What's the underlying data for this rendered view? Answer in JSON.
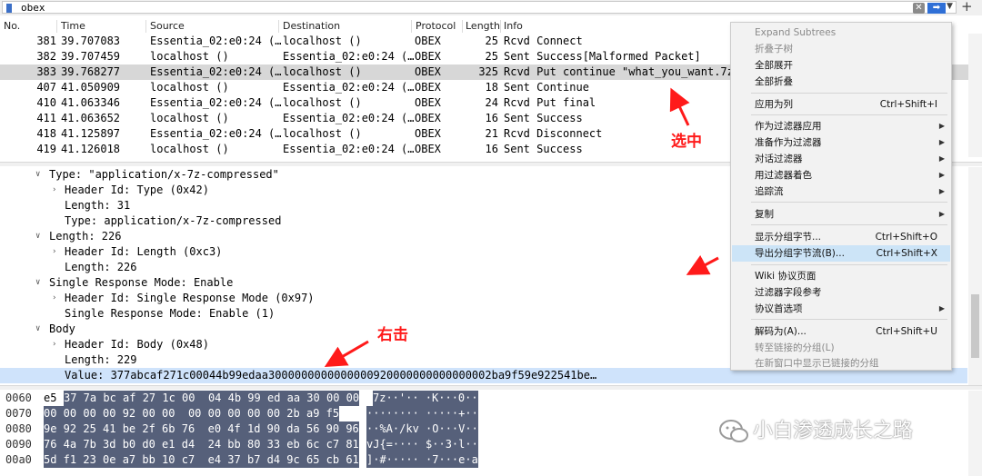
{
  "filter": {
    "value": "obex",
    "clear_glyph": "✕",
    "apply_glyph": "➡",
    "dropdown_glyph": "▼",
    "add_glyph": "+"
  },
  "packet_list": {
    "columns": [
      "No.",
      "Time",
      "Source",
      "Destination",
      "Protocol",
      "Length",
      "Info"
    ],
    "rows": [
      {
        "no": "381",
        "time": "39.707083",
        "source": "Essentia_02:e0:24 (…",
        "destination": "localhost ()",
        "protocol": "OBEX",
        "length": "25",
        "info": "Rcvd Connect"
      },
      {
        "no": "382",
        "time": "39.707459",
        "source": "localhost ()",
        "destination": "Essentia_02:e0:24 (…",
        "protocol": "OBEX",
        "length": "25",
        "info": "Sent Success[Malformed Packet]"
      },
      {
        "no": "383",
        "time": "39.768277",
        "source": "Essentia_02:e0:24 (…",
        "destination": "localhost ()",
        "protocol": "OBEX",
        "length": "325",
        "info": "Rcvd Put continue \"what_you_want.7z\""
      },
      {
        "no": "407",
        "time": "41.050909",
        "source": "localhost ()",
        "destination": "Essentia_02:e0:24 (…",
        "protocol": "OBEX",
        "length": "18",
        "info": "Sent Continue"
      },
      {
        "no": "410",
        "time": "41.063346",
        "source": "Essentia_02:e0:24 (…",
        "destination": "localhost ()",
        "protocol": "OBEX",
        "length": "24",
        "info": "Rcvd Put final"
      },
      {
        "no": "411",
        "time": "41.063652",
        "source": "localhost ()",
        "destination": "Essentia_02:e0:24 (…",
        "protocol": "OBEX",
        "length": "16",
        "info": "Sent Success"
      },
      {
        "no": "418",
        "time": "41.125897",
        "source": "Essentia_02:e0:24 (…",
        "destination": "localhost ()",
        "protocol": "OBEX",
        "length": "21",
        "info": "Rcvd Disconnect"
      },
      {
        "no": "419",
        "time": "41.126018",
        "source": "localhost ()",
        "destination": "Essentia_02:e0:24 (…",
        "protocol": "OBEX",
        "length": "16",
        "info": "Sent Success"
      }
    ]
  },
  "detail_tree": [
    "Type: \"application/x-7z-compressed\"",
    "Header Id: Type (0x42)",
    "Length: 31",
    "Type: application/x-7z-compressed",
    "Length: 226",
    "Header Id: Length (0xc3)",
    "Length: 226",
    "Single Response Mode: Enable",
    "Header Id: Single Response Mode (0x97)",
    "Single Response Mode: Enable (1)",
    "Body",
    "Header Id: Body (0x48)",
    "Length: 229",
    "Value: 377abcaf271c00044b99edaa3000000000000000920000000000000002ba9f59e922541be…"
  ],
  "hex_dump": [
    {
      "offset": "0060",
      "first": "e5",
      "bytes": "37 7a bc af 27 1c 00  04 4b 99 ed aa 30 00 00",
      "ascii": "7z··'·· ·K···0··"
    },
    {
      "offset": "0070",
      "first": "",
      "bytes": "00 00 00 00 92 00 00  00 00 00 00 00 2b a9 f5",
      "ascii": "········ ·····+··"
    },
    {
      "offset": "0080",
      "first": "",
      "bytes": "9e 92 25 41 be 2f 6b 76  e0 4f 1d 90 da 56 90 96",
      "ascii": "··%A·/kv ·O···V··"
    },
    {
      "offset": "0090",
      "first": "",
      "bytes": "76 4a 7b 3d b0 d0 e1 d4  24 bb 80 33 eb 6c c7 81",
      "ascii": "vJ{=···· $··3·l··"
    },
    {
      "offset": "00a0",
      "first": "",
      "bytes": "5d f1 23 0e a7 bb 10 c7  e4 37 b7 d4 9c 65 cb 61",
      "ascii": "]·#····· ·7···e·a"
    }
  ],
  "context_menu": {
    "items": [
      {
        "label": "Expand Subtrees",
        "shortcut": "",
        "disabled": true,
        "submenu": false
      },
      {
        "label": "折叠子树",
        "shortcut": "",
        "disabled": true,
        "submenu": false
      },
      {
        "label": "全部展开",
        "shortcut": "",
        "disabled": false,
        "submenu": false
      },
      {
        "label": "全部折叠",
        "shortcut": "",
        "disabled": false,
        "submenu": false
      },
      {
        "label": "应用为列",
        "shortcut": "Ctrl+Shift+I",
        "disabled": false,
        "submenu": false
      },
      {
        "label": "作为过滤器应用",
        "shortcut": "",
        "disabled": false,
        "submenu": true
      },
      {
        "label": "准备作为过滤器",
        "shortcut": "",
        "disabled": false,
        "submenu": true
      },
      {
        "label": "对话过滤器",
        "shortcut": "",
        "disabled": false,
        "submenu": true
      },
      {
        "label": "用过滤器着色",
        "shortcut": "",
        "disabled": false,
        "submenu": true
      },
      {
        "label": "追踪流",
        "shortcut": "",
        "disabled": false,
        "submenu": true
      },
      {
        "label": "复制",
        "shortcut": "",
        "disabled": false,
        "submenu": true
      },
      {
        "label": "显示分组字节...",
        "shortcut": "Ctrl+Shift+O",
        "disabled": false,
        "submenu": false
      },
      {
        "label": "导出分组字节流(B)...",
        "shortcut": "Ctrl+Shift+X",
        "disabled": false,
        "submenu": false
      },
      {
        "label": "Wiki 协议页面",
        "shortcut": "",
        "disabled": false,
        "submenu": false
      },
      {
        "label": "过滤器字段参考",
        "shortcut": "",
        "disabled": false,
        "submenu": false
      },
      {
        "label": "协议首选项",
        "shortcut": "",
        "disabled": false,
        "submenu": true
      },
      {
        "label": "解码为(A)...",
        "shortcut": "Ctrl+Shift+U",
        "disabled": false,
        "submenu": false
      },
      {
        "label": "转至链接的分组(L)",
        "shortcut": "",
        "disabled": true,
        "submenu": false
      },
      {
        "label": "在新窗口中显示已链接的分组",
        "shortcut": "",
        "disabled": true,
        "submenu": false
      }
    ],
    "submenu_glyph": "▶"
  },
  "annotations": {
    "selected_label": "选中",
    "right_click_label": "右击",
    "color": "#ff1a1a"
  },
  "watermark": {
    "text": "小白渗透成长之路"
  },
  "tree_glyphs": {
    "expanded": "∨",
    "collapsed": "›"
  }
}
